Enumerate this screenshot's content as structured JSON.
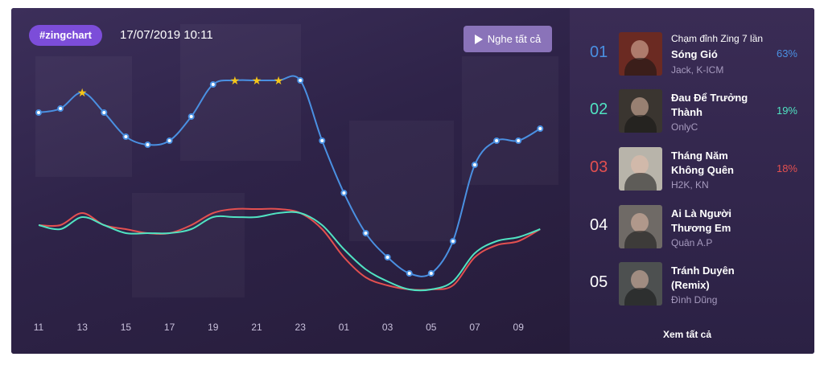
{
  "header": {
    "tag": "#zingchart",
    "datetime": "17/07/2019 10:11",
    "play_all_label": "Nghe tất cả"
  },
  "chart_data": {
    "type": "line",
    "x": [
      "11",
      "12",
      "13",
      "14",
      "15",
      "16",
      "17",
      "18",
      "19",
      "20",
      "21",
      "22",
      "23",
      "00",
      "01",
      "02",
      "03",
      "04",
      "05",
      "06",
      "07",
      "08",
      "09",
      "10"
    ],
    "tick_labels": [
      "11",
      "13",
      "15",
      "17",
      "19",
      "21",
      "23",
      "01",
      "03",
      "05",
      "07",
      "09"
    ],
    "series": [
      {
        "color": "#4a90e2",
        "values": [
          58,
          59,
          63,
          58,
          52,
          50,
          51,
          57,
          65,
          66,
          66,
          66,
          66,
          51,
          38,
          28,
          22,
          18,
          18,
          26,
          45,
          51,
          51,
          54
        ]
      },
      {
        "color": "#50e3c2",
        "values": [
          30,
          29,
          32,
          30,
          28,
          28,
          28,
          29,
          32,
          32,
          32,
          33,
          33,
          30,
          24,
          19,
          16,
          14,
          14,
          16,
          23,
          26,
          27,
          29
        ]
      },
      {
        "color": "#e35050",
        "values": [
          30,
          30,
          33,
          30,
          29,
          28,
          28,
          30,
          33,
          34,
          34,
          34,
          33,
          29,
          22,
          17,
          15,
          14,
          14,
          15,
          22,
          25,
          26,
          29
        ]
      }
    ],
    "stars_at": [
      "13",
      "20",
      "21",
      "22"
    ],
    "ylim": [
      0,
      80
    ]
  },
  "ranking": {
    "items": [
      {
        "rank": "01",
        "rank_color": "#4a90e2",
        "extra": "Chạm đỉnh Zing 7 lần",
        "title": "Sóng Gió",
        "artist": "Jack, K-ICM",
        "percent": "63%",
        "percent_color": "#4a90e2",
        "thumb_color": "#6b2a22"
      },
      {
        "rank": "02",
        "rank_color": "#50e3c2",
        "title": "Đau Để Trưởng Thành",
        "artist": "OnlyC",
        "percent": "19%",
        "percent_color": "#50e3c2",
        "thumb_color": "#3a3530"
      },
      {
        "rank": "03",
        "rank_color": "#e35050",
        "title": "Tháng Năm Không Quên",
        "artist": "H2K, KN",
        "percent": "18%",
        "percent_color": "#e35050",
        "thumb_color": "#b8b4aa"
      },
      {
        "rank": "04",
        "rank_color": "#ffffff",
        "title": "Ai Là Người Thương Em",
        "artist": "Quân A.P",
        "thumb_color": "#6f6a66"
      },
      {
        "rank": "05",
        "rank_color": "#ffffff",
        "title": "Tránh Duyên (Remix)",
        "artist": "Đình Dũng",
        "thumb_color": "#4d5050"
      }
    ],
    "view_all_label": "Xem tất cả"
  }
}
